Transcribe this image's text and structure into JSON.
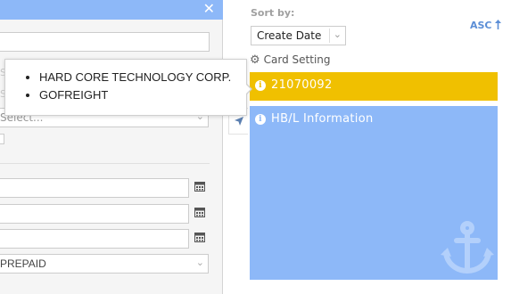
{
  "left_panel": {
    "close_icon": "close-icon",
    "select_placeholder": "Select...",
    "freight_term": "PREPAID",
    "ghost_labels": [
      "Sc",
      "Sc"
    ],
    "colors": {
      "header": "#8db8f8"
    }
  },
  "sort": {
    "label": "Sort by:",
    "selected": "Create Date",
    "direction": "ASC",
    "direction_icon": "arrow-up-icon"
  },
  "card_setting": {
    "label": "Card Setting",
    "icon": "gears-icon"
  },
  "cards": [
    {
      "title": "21070092",
      "color": "#f0c000",
      "icon": "info-circle-icon"
    },
    {
      "title": "HB/L Information",
      "color": "#8db8f8",
      "icon": "info-circle-icon",
      "watermark": "anchor-icon"
    }
  ],
  "tooltip": {
    "items": [
      "HARD CORE TECHNOLOGY CORP.",
      "GOFREIGHT"
    ]
  }
}
